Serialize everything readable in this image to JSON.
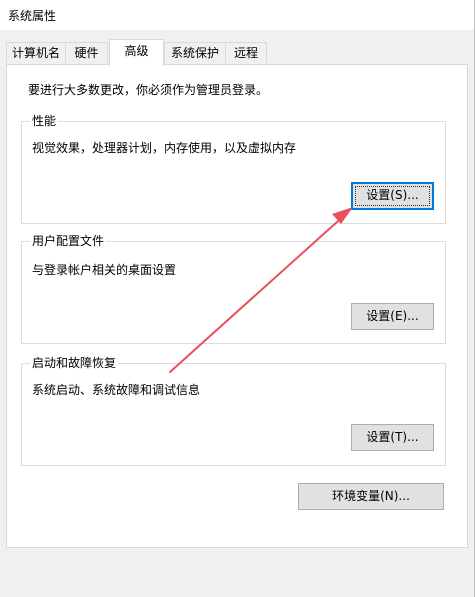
{
  "window": {
    "title": "系统属性"
  },
  "tabs": [
    {
      "label": "计算机名",
      "active": false
    },
    {
      "label": "硬件",
      "active": false
    },
    {
      "label": "高级",
      "active": true
    },
    {
      "label": "系统保护",
      "active": false
    },
    {
      "label": "远程",
      "active": false
    }
  ],
  "admin_note": "要进行大多数更改，你必须作为管理员登录。",
  "performance": {
    "title": "性能",
    "description": "视觉效果，处理器计划，内存使用，以及虚拟内存",
    "button": "设置(S)..."
  },
  "user_profiles": {
    "title": "用户配置文件",
    "description": "与登录帐户相关的桌面设置",
    "button": "设置(E)..."
  },
  "startup_recovery": {
    "title": "启动和故障恢复",
    "description": "系统启动、系统故障和调试信息",
    "button": "设置(T)..."
  },
  "env_button": "环境变量(N)...",
  "colors": {
    "accent": "#0078d7",
    "annotation_arrow": "#e8505b"
  }
}
